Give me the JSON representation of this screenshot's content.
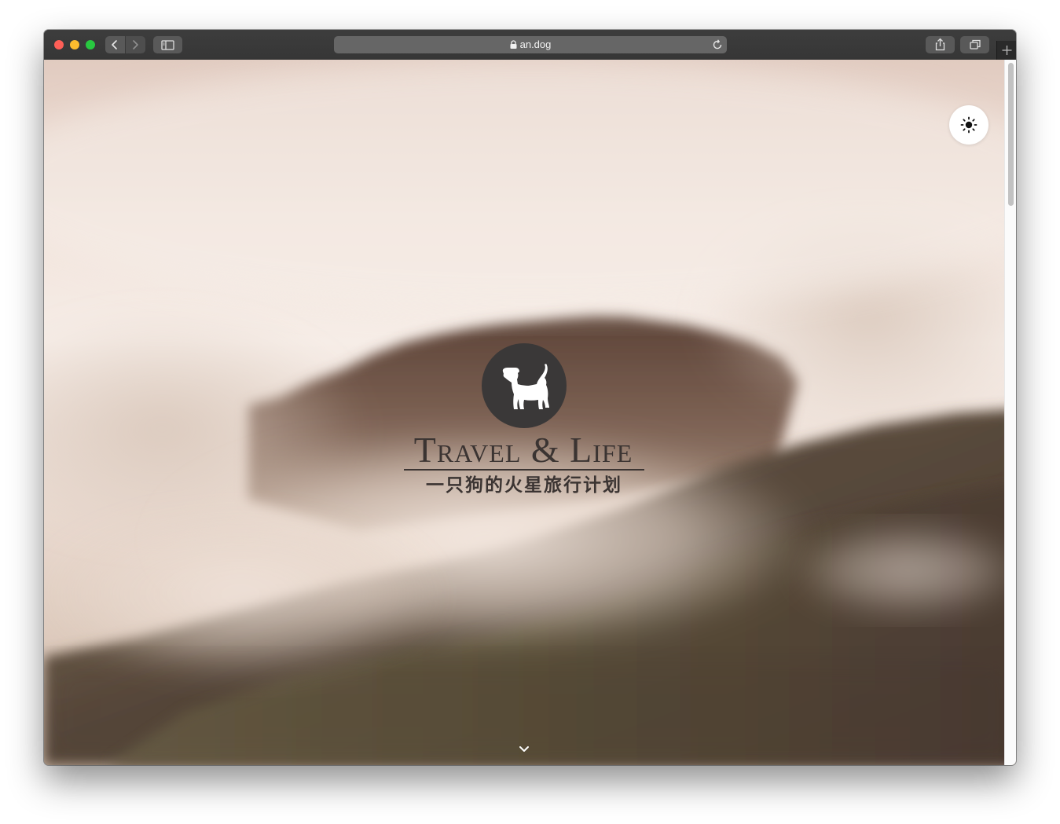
{
  "browser": {
    "url": "an.dog",
    "back_icon": "chevron-left-icon",
    "forward_icon": "chevron-right-icon",
    "sidebar_icon": "sidebar-icon",
    "share_icon": "share-icon",
    "tabs_icon": "tabs-overview-icon",
    "new_tab_icon": "plus-icon",
    "lock_icon": "lock-icon",
    "reload_icon": "reload-icon"
  },
  "page": {
    "theme_toggle_icon": "sun-icon",
    "logo_icon": "dog-icon",
    "title": "Travel & Life",
    "subtitle": "一只狗的火星旅行计划",
    "scroll_icon": "chevron-down-icon"
  },
  "colors": {
    "logo_circle": "#3a3838",
    "title_text": "#3b3432",
    "toolbar": "#3a3a3a"
  }
}
